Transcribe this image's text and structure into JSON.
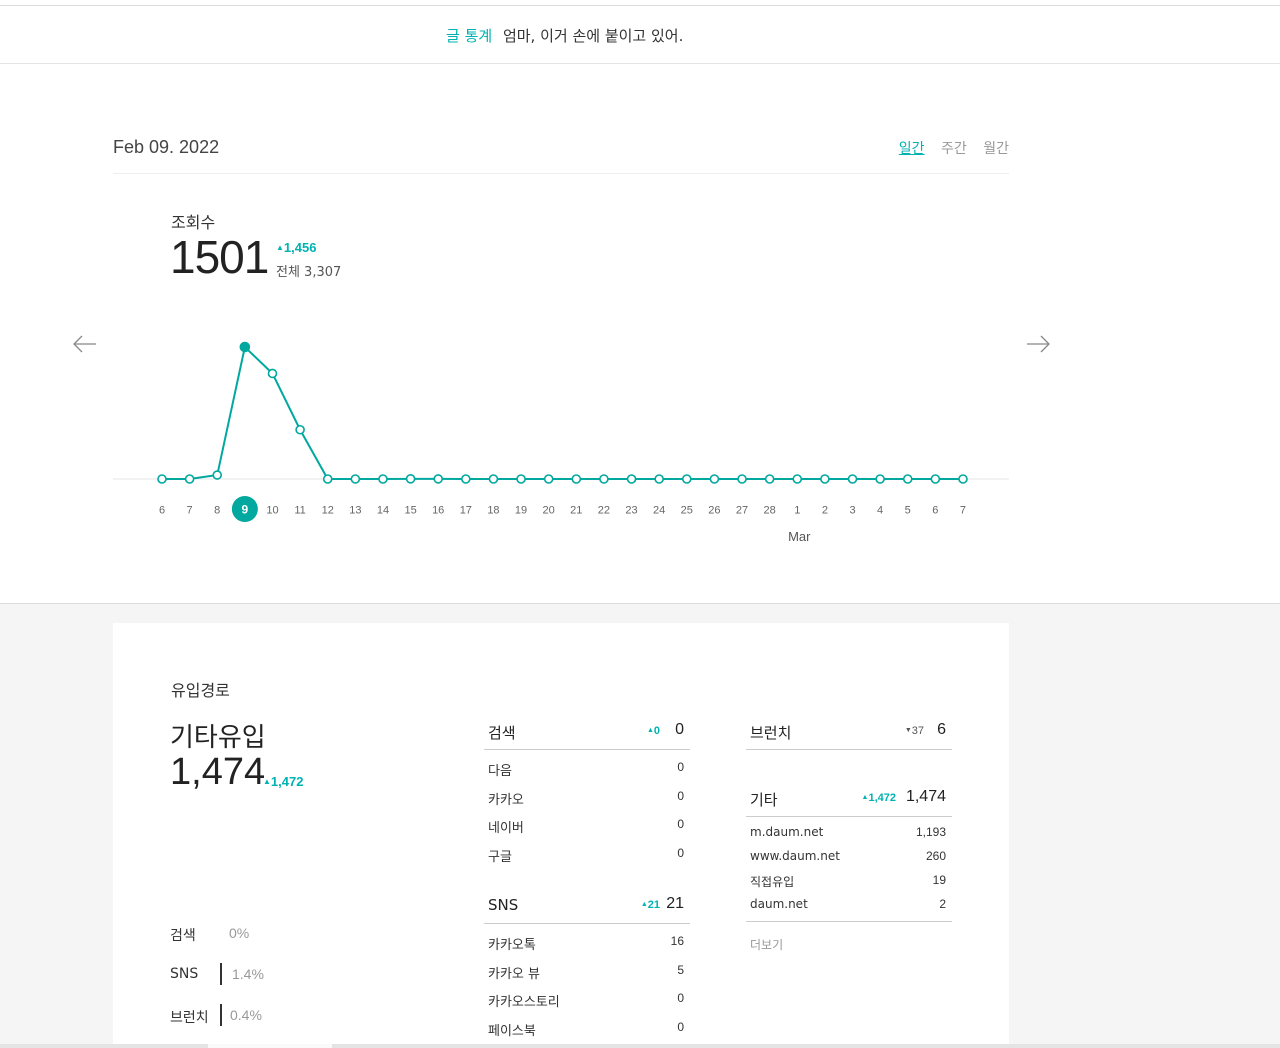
{
  "header": {
    "label": "글 통계",
    "title": "엄마, 이거 손에 붙이고 있어."
  },
  "date": "Feb 09. 2022",
  "tabs": [
    {
      "label": "일간",
      "active": true
    },
    {
      "label": "주간",
      "active": false
    },
    {
      "label": "월간",
      "active": false
    }
  ],
  "views": {
    "label": "조회수",
    "value": "1501",
    "change": "1,456",
    "total": "전체 3,307"
  },
  "nav": {
    "prev_icon": "arrow-left-icon",
    "next_icon": "arrow-right-icon"
  },
  "chart_data": {
    "type": "line",
    "categories": [
      "6",
      "7",
      "8",
      "9",
      "10",
      "11",
      "12",
      "13",
      "14",
      "15",
      "16",
      "17",
      "18",
      "19",
      "20",
      "21",
      "22",
      "23",
      "24",
      "25",
      "26",
      "27",
      "28",
      "1",
      "2",
      "3",
      "4",
      "5",
      "6",
      "7"
    ],
    "values": [
      0,
      0,
      45,
      1501,
      1200,
      560,
      0,
      0,
      0,
      2,
      1,
      0,
      0,
      0,
      0,
      0,
      0,
      0,
      0,
      0,
      0,
      0,
      0,
      0,
      0,
      0,
      0,
      0,
      0,
      0
    ],
    "selected_index": 3,
    "month_label": "Mar",
    "month_label_index": 23,
    "color": "#00a89f"
  },
  "sources": {
    "title": "유입경로",
    "top_name": "기타유입",
    "top_value": "1,474",
    "top_change": "1,472",
    "percents": [
      {
        "name": "검색",
        "value": "0%"
      },
      {
        "name": "SNS",
        "value": "1.4%"
      },
      {
        "name": "브런치",
        "value": "0.4%"
      }
    ],
    "search": {
      "name": "검색",
      "change": "0",
      "total": "0",
      "rows": [
        {
          "name": "다음",
          "value": "0"
        },
        {
          "name": "카카오",
          "value": "0"
        },
        {
          "name": "네이버",
          "value": "0"
        },
        {
          "name": "구글",
          "value": "0"
        }
      ]
    },
    "sns": {
      "name": "SNS",
      "change": "21",
      "total": "21",
      "rows": [
        {
          "name": "카카오톡",
          "value": "16"
        },
        {
          "name": "카카오 뷰",
          "value": "5"
        },
        {
          "name": "카카오스토리",
          "value": "0"
        },
        {
          "name": "페이스북",
          "value": "0"
        }
      ]
    },
    "brunch": {
      "name": "브런치",
      "change": "37",
      "total": "6"
    },
    "etc": {
      "name": "기타",
      "change": "1,472",
      "total": "1,474",
      "rows": [
        {
          "name": "m.daum.net",
          "value": "1,193"
        },
        {
          "name": "www.daum.net",
          "value": "260"
        },
        {
          "name": "직접유입",
          "value": "19"
        },
        {
          "name": "daum.net",
          "value": "2"
        }
      ],
      "more_label": "더보기"
    },
    "colors": {
      "accent": "#00b2b2"
    }
  }
}
